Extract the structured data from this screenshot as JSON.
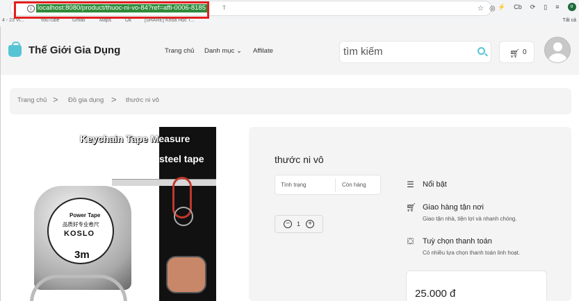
{
  "browser": {
    "url": "localhost:8080/product/thuoc-ni-vo-84?ref=affi-0006-8185",
    "url_tail": "T",
    "info_icon": "i",
    "icons": [
      "☆",
      "◎"
    ],
    "extensions": [
      "⚡",
      "Cb",
      "⟳",
      "▯",
      "≡"
    ],
    "profile_initial": "o",
    "bookmarks": [
      "4 - 23 Vi...",
      "YouTube",
      "Gmail",
      "Maps",
      "Ok",
      "[SHARE] Khóa Học T..."
    ],
    "all_bookmarks": "Tất cả"
  },
  "header": {
    "brand": "Thế Giới Gia Dụng",
    "nav": {
      "home": "Trang chủ",
      "category": "Danh mục",
      "affiliate": "Affilate"
    },
    "search_placeholder": "tìm kiếm",
    "cart_count": "0"
  },
  "breadcrumb": {
    "home": "Trang chủ",
    "category": "Đồ gia dụng",
    "current": "thước ni vô",
    "separator": ">"
  },
  "product_image": {
    "title_line1": "Keychain Tape Measure",
    "title_line2": "steel tape",
    "brand_line1": "Power Tape",
    "brand_line2": "品质好专业卷尺",
    "brand_line3": "KOSLO",
    "size": "3m"
  },
  "product": {
    "title": "thước ni vô",
    "status_label": "Tình trạng",
    "status_value": "Còn hàng",
    "qty_minus": "−",
    "qty_plus": "+",
    "quantity": "1",
    "price": "25.000 đ"
  },
  "features": [
    {
      "icon": "featured-icon",
      "title": "Nổi bật",
      "desc": ""
    },
    {
      "icon": "cart-icon",
      "title": "Giao hàng tận nơi",
      "desc": "Giao tận nhà, tiện lợi và nhanh chóng."
    },
    {
      "icon": "bag-icon",
      "title": "Tuỳ chọn thanh toán",
      "desc": "Có nhiều lựa chọn thanh toán linh hoạt."
    }
  ],
  "colors": {
    "accent": "#57c4d4",
    "url_highlight": "#2f8a3a",
    "annotation": "#e41e1e",
    "panel": "#f4f4f5"
  }
}
